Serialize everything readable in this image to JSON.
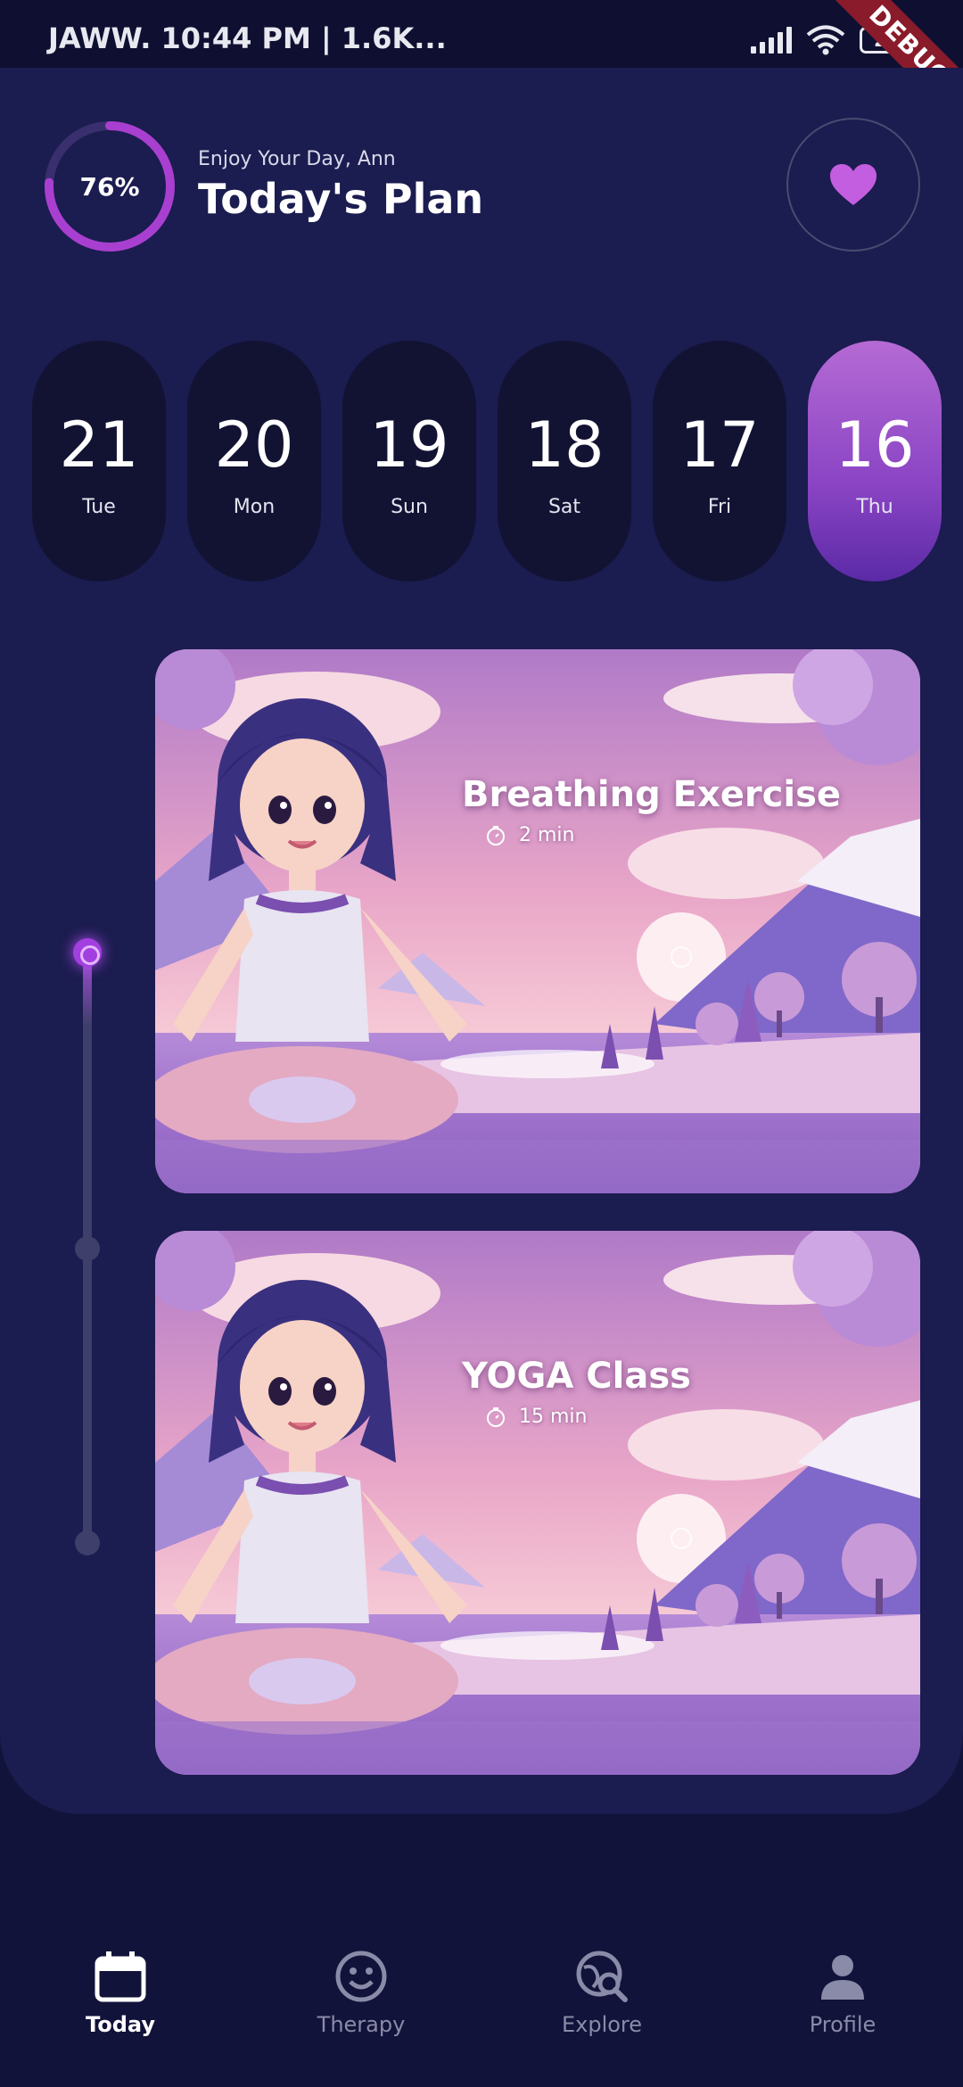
{
  "status_bar": {
    "left_text": "JAWW. 10:44 PM | 1.6K...",
    "battery": "28",
    "debug_label": "DEBUG"
  },
  "header": {
    "progress_label": "76%",
    "progress_value": 0.76,
    "greeting": "Enjoy Your Day, Ann",
    "title": "Today's Plan",
    "favorite_icon": "heart-icon"
  },
  "dates": [
    {
      "num": "21",
      "day": "Tue",
      "active": false
    },
    {
      "num": "20",
      "day": "Mon",
      "active": false
    },
    {
      "num": "19",
      "day": "Sun",
      "active": false
    },
    {
      "num": "18",
      "day": "Sat",
      "active": false
    },
    {
      "num": "17",
      "day": "Fri",
      "active": false
    },
    {
      "num": "16",
      "day": "Thu",
      "active": true
    }
  ],
  "activities": [
    {
      "title": "Breathing Exercise",
      "duration": "2 min"
    },
    {
      "title": "YOGA Class",
      "duration": "15 min"
    }
  ],
  "nav": [
    {
      "label": "Today",
      "icon": "calendar-icon",
      "active": true
    },
    {
      "label": "Therapy",
      "icon": "smiley-icon",
      "active": false
    },
    {
      "label": "Explore",
      "icon": "globe-search-icon",
      "active": false
    },
    {
      "label": "Profile",
      "icon": "person-icon",
      "active": false
    }
  ],
  "colors": {
    "background": "#12133a",
    "panel": "#1b1c4f",
    "accent": "#a23fe0",
    "pill": "#121333",
    "heart": "#c35ee0"
  }
}
